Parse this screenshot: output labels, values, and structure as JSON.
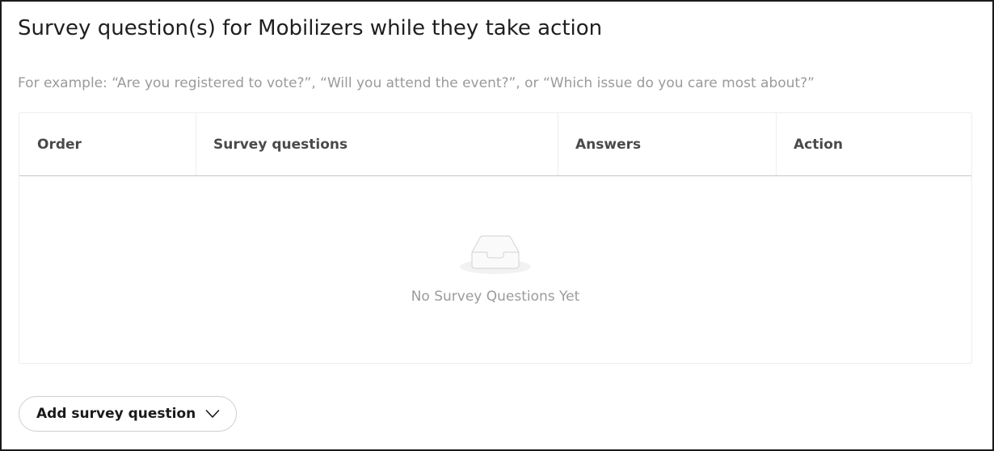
{
  "section": {
    "title": "Survey question(s) for Mobilizers while they take action",
    "example_text": "For example: “Are you registered to vote?”, “Will you attend the event?”, or “Which issue do you care most about?”"
  },
  "table": {
    "columns": {
      "order": "Order",
      "questions": "Survey questions",
      "answers": "Answers",
      "action": "Action"
    },
    "rows": [],
    "empty_state": {
      "icon": "empty-inbox-icon",
      "message": "No Survey Questions Yet"
    }
  },
  "add_button": {
    "label": "Add survey question",
    "icon": "chevron-down-icon"
  }
}
